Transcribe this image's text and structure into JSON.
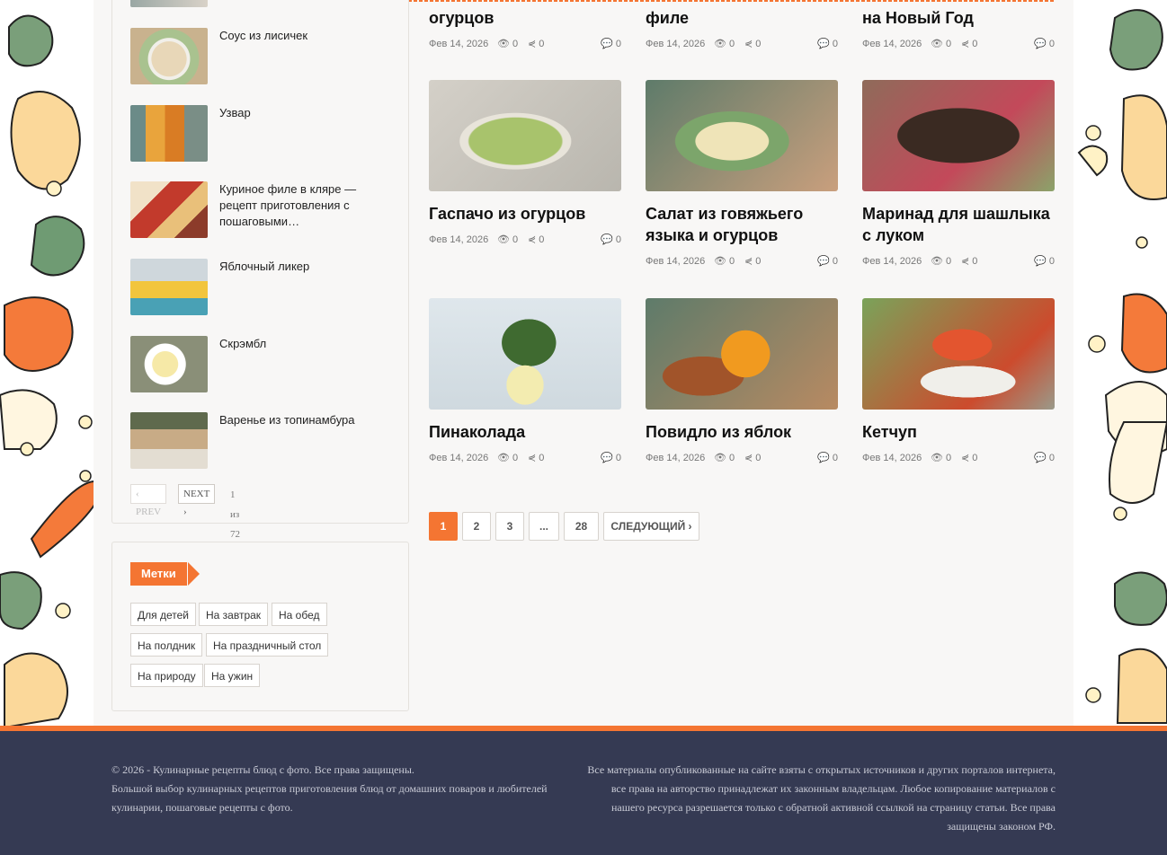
{
  "sidebar": {
    "recent_items": [
      {
        "title": "Соус из лисичек"
      },
      {
        "title": "Узвар"
      },
      {
        "title": "Куриное филе в кляре — рецепт приготовления с пошаговыми…"
      },
      {
        "title": "Яблочный ликер"
      },
      {
        "title": "Скрэмбл"
      },
      {
        "title": "Варенье из топинамбура"
      }
    ],
    "pager": {
      "prev": "‹ PREV",
      "next": "NEXT ›",
      "count": "1 из 72"
    },
    "tags_title": "Метки",
    "tags": [
      "Для детей",
      "На завтрак",
      "На обед",
      "На полдник",
      "На праздничный стол",
      "На природу",
      "На ужин"
    ]
  },
  "posts_top_row": [
    {
      "title": "огурцов",
      "date": "Фев 14, 2026",
      "views": "0",
      "shares": "0",
      "comments": "0"
    },
    {
      "title": "филе",
      "date": "Фев 14, 2026",
      "views": "0",
      "shares": "0",
      "comments": "0"
    },
    {
      "title": "на Новый Год",
      "date": "Фев 14, 2026",
      "views": "0",
      "shares": "0",
      "comments": "0"
    }
  ],
  "posts": [
    {
      "title": "Гаспачо из огурцов",
      "date": "Фев 14, 2026",
      "views": "0",
      "shares": "0",
      "comments": "0"
    },
    {
      "title": "Салат из говяжьего языка и огурцов",
      "date": "Фев 14, 2026",
      "views": "0",
      "shares": "0",
      "comments": "0"
    },
    {
      "title": "Маринад для шашлыка с луком",
      "date": "Фев 14, 2026",
      "views": "0",
      "shares": "0",
      "comments": "0"
    },
    {
      "title": "Пинаколада",
      "date": "Фев 14, 2026",
      "views": "0",
      "shares": "0",
      "comments": "0"
    },
    {
      "title": "Повидло из яблок",
      "date": "Фев 14, 2026",
      "views": "0",
      "shares": "0",
      "comments": "0"
    },
    {
      "title": "Кетчуп",
      "date": "Фев 14, 2026",
      "views": "0",
      "shares": "0",
      "comments": "0"
    }
  ],
  "pagination": {
    "pages": [
      "1",
      "2",
      "3",
      "...",
      "28"
    ],
    "next": "СЛЕДУЮЩИЙ ›",
    "current": "1"
  },
  "footer": {
    "left_line1": "© 2026 - Кулинарные рецепты блюд с фото. Все права защищены.",
    "left_line2": "Большой выбор кулинарных рецептов приготовления блюд от домашних поваров и любителей кулинарии, пошаговые рецепты с фото.",
    "right": "Все материалы опубликованные на сайте взяты с открытых источников и других порталов интернета, все права на авторство принадлежат их законным владельцам. Любое копирование материалов с нашего ресурса разрешается только с обратной активной ссылкой на страницу статьи. Все права защищены законом РФ."
  },
  "colors": {
    "accent": "#f47532",
    "footer_bg": "#353a53",
    "page_bg": "#f8f7f6"
  }
}
